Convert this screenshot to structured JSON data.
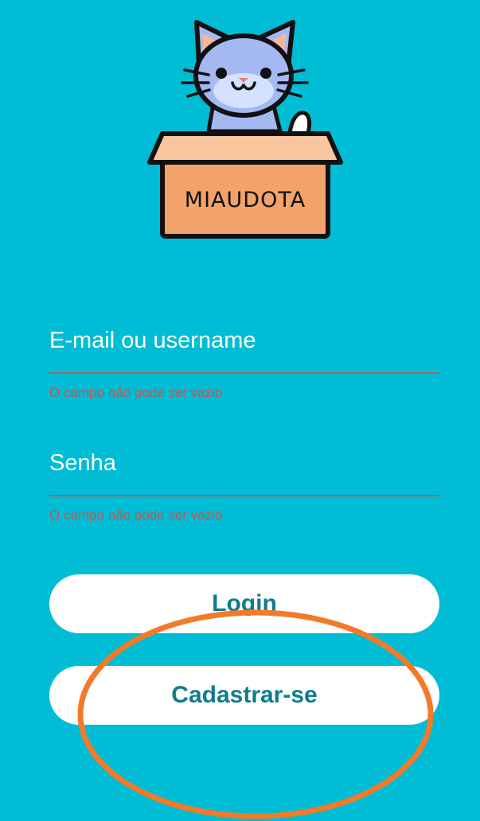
{
  "app": {
    "logo_text": "MIAUDOTA"
  },
  "colors": {
    "background": "#00bcd4",
    "accent_text": "#0e7d8c",
    "error": "#c2574e",
    "highlight_ring": "#f47a2a"
  },
  "form": {
    "email": {
      "placeholder": "E-mail ou username",
      "value": "",
      "error": "O campo não pode ser vazio"
    },
    "password": {
      "placeholder": "Senha",
      "value": "",
      "error": "O campo não pode ser vazio"
    }
  },
  "buttons": {
    "login_label": "Login",
    "signup_label": "Cadastrar-se"
  }
}
